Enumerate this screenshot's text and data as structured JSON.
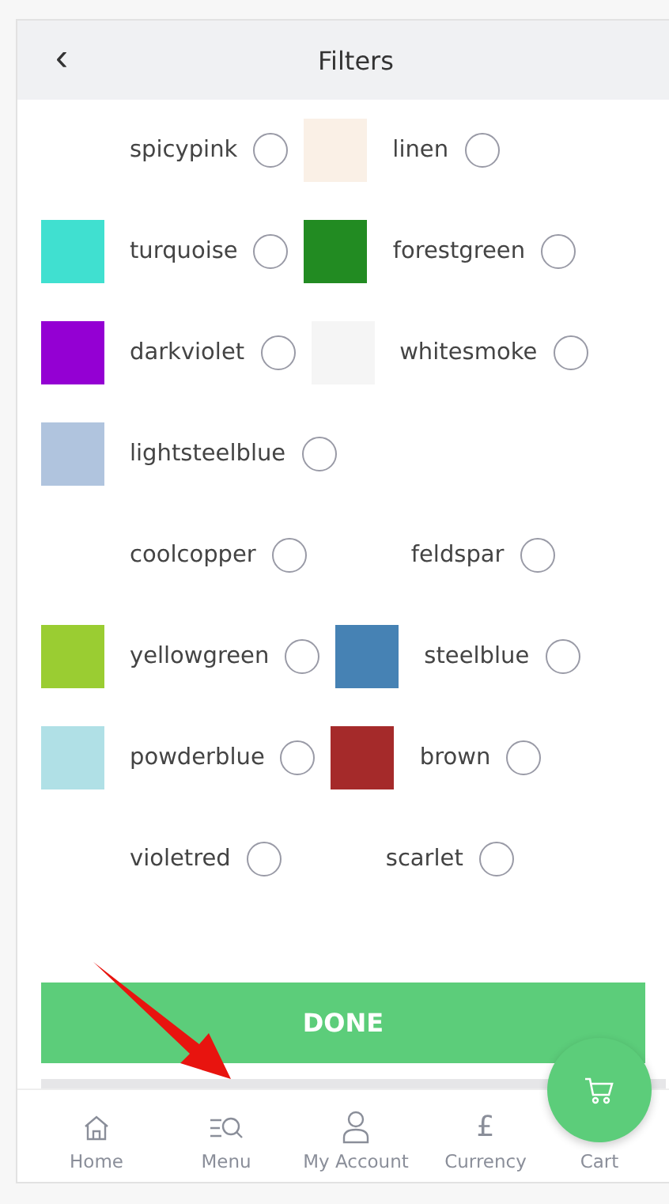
{
  "header": {
    "back": "‹",
    "title": "Filters"
  },
  "rows": [
    {
      "items": [
        {
          "label": "spicypink",
          "selected": false
        },
        {
          "label": "linen",
          "color": "#faf0e6",
          "selected": false
        }
      ]
    },
    {
      "items": [
        {
          "label": "turquoise",
          "color": "#40e0d0",
          "selected": false
        },
        {
          "label": "forestgreen",
          "color": "#228b22",
          "selected": false
        }
      ]
    },
    {
      "items": [
        {
          "label": "darkviolet",
          "color": "#9400d3",
          "selected": false
        },
        {
          "label": "whitesmoke",
          "color": "#f5f5f5",
          "selected": false
        }
      ]
    },
    {
      "items": [
        {
          "label": "lightsteelblue",
          "color": "#b0c4de",
          "selected": false
        }
      ]
    },
    {
      "items": [
        {
          "label": "coolcopper",
          "selected": false
        },
        {
          "label": "feldspar",
          "selected": false
        }
      ]
    },
    {
      "items": [
        {
          "label": "yellowgreen",
          "color": "#9acd32",
          "selected": false
        },
        {
          "label": "steelblue",
          "color": "#4682b4",
          "selected": false
        }
      ]
    },
    {
      "items": [
        {
          "label": "powderblue",
          "color": "#b0e0e6",
          "selected": false
        },
        {
          "label": "brown",
          "color": "#a52a2a",
          "selected": false
        }
      ]
    },
    {
      "items": [
        {
          "label": "violetred",
          "selected": false
        },
        {
          "label": "scarlet",
          "selected": false
        }
      ]
    }
  ],
  "done_button": "DONE",
  "nav": [
    {
      "kind": "home",
      "label": "Home"
    },
    {
      "kind": "menu",
      "label": "Menu"
    },
    {
      "kind": "account",
      "label": "My Account"
    },
    {
      "kind": "currency",
      "label": "Currency",
      "glyph": "£"
    },
    {
      "kind": "cart",
      "label": "Cart"
    }
  ]
}
